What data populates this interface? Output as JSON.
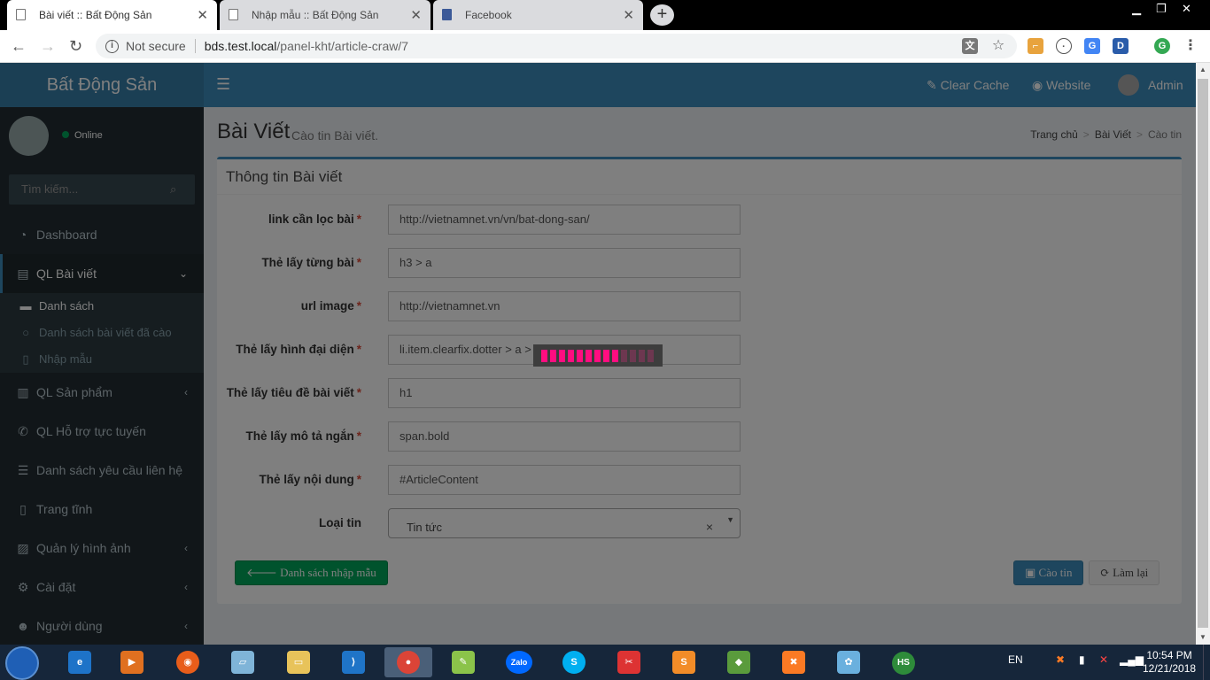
{
  "browser": {
    "tabs": [
      {
        "title": "Bài viết :: Bất Động Sản",
        "active": true
      },
      {
        "title": "Nhập mẫu :: Bất Động Sản",
        "active": false
      },
      {
        "title": "Facebook",
        "active": false
      }
    ],
    "newtab": "+",
    "security": "Not secure",
    "url_host": "bds.test.local",
    "url_path": "/panel-kht/article-craw/7",
    "profile_initial": "G",
    "ext_d": "D"
  },
  "app": {
    "brand": "Bất Động Sản",
    "nav": {
      "clear_cache": "Clear Cache",
      "website": "Website",
      "admin": "Admin"
    },
    "user_status": "Online",
    "search_placeholder": "Tìm kiếm...",
    "menu": {
      "dashboard": "Dashboard",
      "articles": "QL Bài viết",
      "list": "Danh sách",
      "crawled": "Danh sách bài viết đã cào",
      "import": "Nhập mẫu",
      "products": "QL Sản phẩm",
      "support": "QL Hỗ trợ tực tuyến",
      "contacts": "Danh sách yêu cầu liên hệ",
      "static": "Trang tĩnh",
      "images": "Quản lý hình ảnh",
      "settings": "Cài đặt",
      "users": "Người dùng"
    }
  },
  "page": {
    "title": "Bài Viết",
    "subtitle": "Cào tin Bài viết.",
    "breadcrumb": [
      "Trang chủ",
      "Bài Viết",
      "Cào tin"
    ],
    "box_title": "Thông tin Bài viết",
    "fields": [
      {
        "label": "link cần lọc bài",
        "value": "http://vietnamnet.vn/vn/bat-dong-san/"
      },
      {
        "label": "Thẻ lấy từng bài",
        "value": "h3 > a"
      },
      {
        "label": "url image",
        "value": "http://vietnamnet.vn"
      },
      {
        "label": "Thẻ lấy hình đại diện",
        "value": "li.item.clearfix.dotter > a > img"
      },
      {
        "label": "Thẻ lấy tiêu đề bài viết",
        "value": "h1"
      },
      {
        "label": "Thẻ lấy mô tả ngắn",
        "value": "span.bold"
      },
      {
        "label": "Thẻ lấy nội dung",
        "value": "#ArticleContent"
      }
    ],
    "select_label": "Loại tin",
    "select_value": "Tin tức",
    "buttons": {
      "back": "Danh sách nhập mẫu",
      "crawl": "Cào tin",
      "reset": "Làm lại"
    },
    "loader": {
      "bars": 13,
      "lit": 9
    }
  },
  "taskbar": {
    "lang": "EN",
    "time": "10:54 PM",
    "date": "12/21/2018",
    "zalo": "Zalo",
    "hs": "HS"
  },
  "colors": {
    "primary": "#3c8dbc",
    "sidebar": "#222d32",
    "success": "#00a65a",
    "danger": "#dd4b39",
    "loader": "#ff0d80"
  }
}
